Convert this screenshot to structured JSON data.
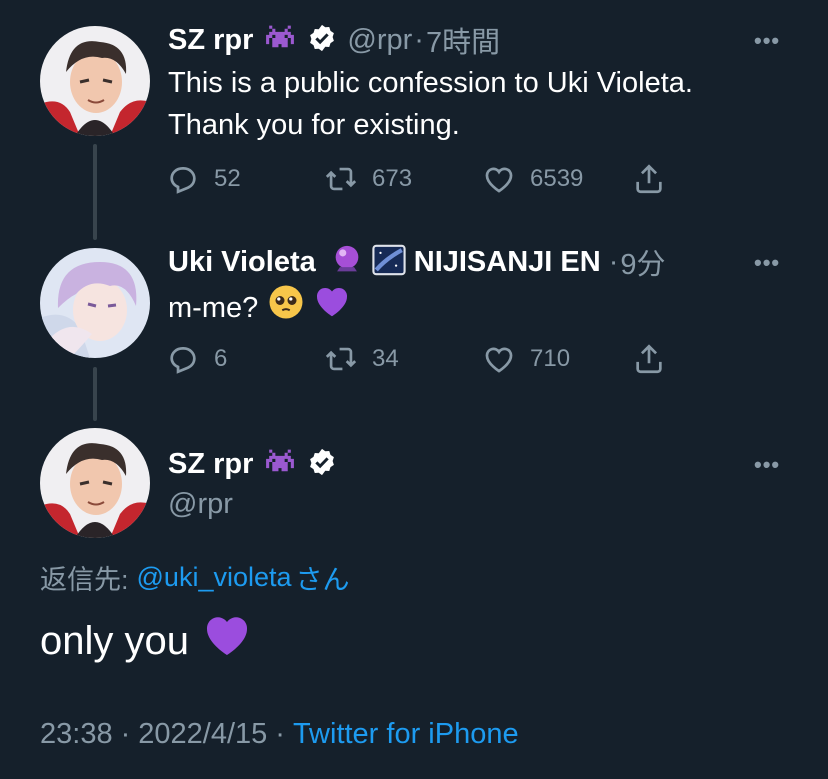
{
  "tweet1": {
    "display_name": "SZ rpr",
    "handle": "@rpr",
    "separator": "·",
    "time": "7時間",
    "text_line1": "This is a public confession to Uki Violeta.",
    "text_line2": "Thank you for existing.",
    "reply_count": "52",
    "retweet_count": "673",
    "like_count": "6539"
  },
  "tweet2": {
    "display_name": "Uki Violeta",
    "org": "NIJISANJI EN",
    "separator": "·",
    "time": "9分",
    "text": "m-me?",
    "reply_count": "6",
    "retweet_count": "34",
    "like_count": "710"
  },
  "tweet3": {
    "display_name": "SZ rpr",
    "handle": "@rpr",
    "reply_to_label": "返信先:",
    "reply_to_handle": "@uki_violeta",
    "reply_to_suffix": "さん",
    "text": "only you",
    "time": "23:38",
    "date": "2022/4/15",
    "dot": "·",
    "source": "Twitter for iPhone"
  },
  "icons": {
    "more": "more-icon",
    "reply": "reply-icon",
    "retweet": "retweet-icon",
    "like": "heart-icon",
    "share": "share-icon",
    "verified": "verified-icon",
    "alien": "space-invader-icon"
  },
  "colors": {
    "background": "#15202b",
    "muted": "#8899a6",
    "link": "#1d9bf0",
    "purple_heart": "#9b4dde"
  },
  "more_glyph": "•••"
}
